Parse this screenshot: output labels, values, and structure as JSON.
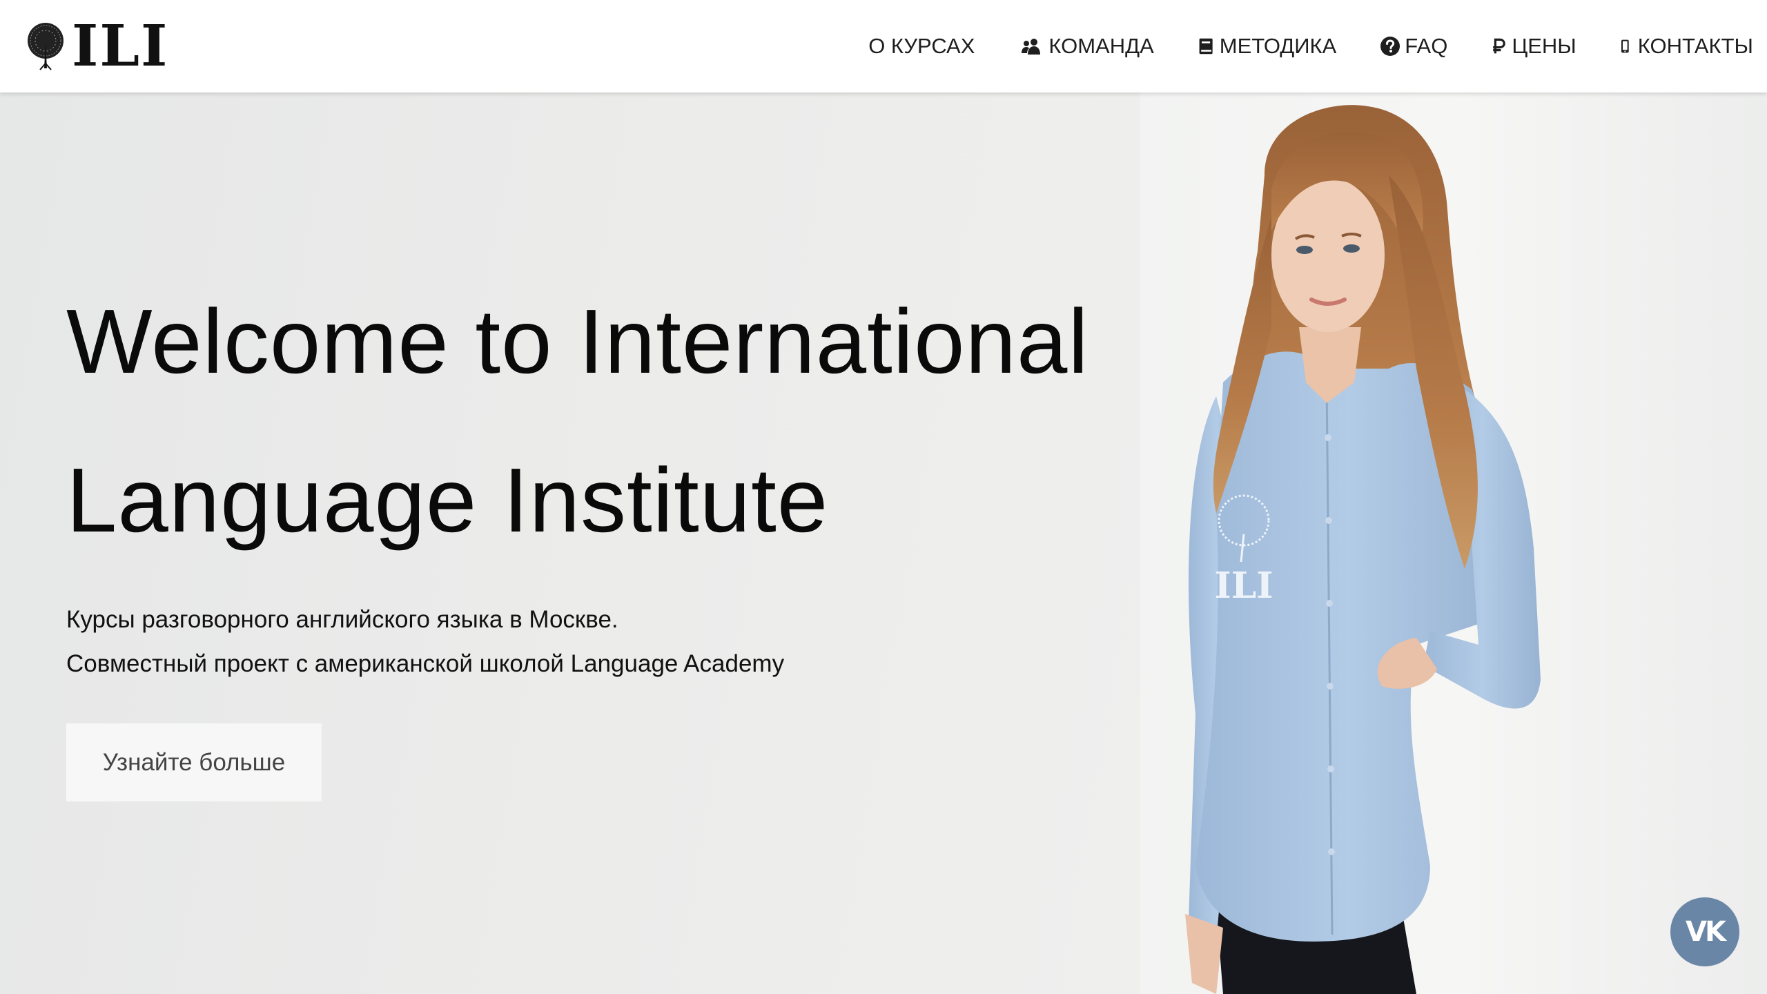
{
  "header": {
    "logo_text": "ILI",
    "nav": [
      {
        "label": "О КУРСАХ",
        "icon": "none"
      },
      {
        "label": "КОМАНДА",
        "icon": "users-icon"
      },
      {
        "label": "МЕТОДИКА",
        "icon": "book-icon"
      },
      {
        "label": "FAQ",
        "icon": "question-circle-icon"
      },
      {
        "label": "ЦЕНЫ",
        "icon": "ruble-icon"
      },
      {
        "label": "КОНТАКТЫ",
        "icon": "mobile-phone-icon"
      }
    ]
  },
  "hero": {
    "title_line1": "Welcome to International",
    "title_line2": "Language Institute",
    "subtitle_line1": "Курсы разговорного английского языка в Москве.",
    "subtitle_line2": "Совместный проект с американской школой Language Academy",
    "cta_label": "Узнайте больше",
    "photo_shirt_logo": "ILI"
  },
  "social": {
    "vk_label": "VK"
  },
  "colors": {
    "header_bg": "#ffffff",
    "hero_bg": "#ebebea",
    "cta_bg": "#f7f7f7",
    "vk_blue": "#6a86a6",
    "shirt_blue": "#a9c3e0",
    "hair": "#b27545"
  }
}
